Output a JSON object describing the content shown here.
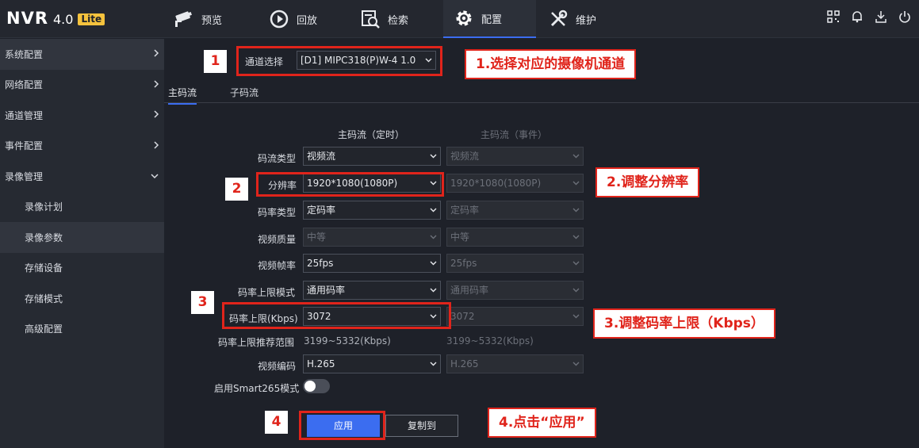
{
  "app": {
    "logo": "NVR",
    "version": "4.0",
    "edition": "Lite"
  },
  "nav": [
    {
      "label": "预览",
      "icon": "camera-icon"
    },
    {
      "label": "回放",
      "icon": "playback-icon"
    },
    {
      "label": "检索",
      "icon": "search-icon"
    },
    {
      "label": "配置",
      "icon": "gear-icon",
      "active": true
    },
    {
      "label": "维护",
      "icon": "wrench-icon"
    }
  ],
  "top_right_icons": [
    "qr-code-icon",
    "bell-icon",
    "download-icon",
    "power-icon"
  ],
  "sidebar": [
    {
      "label": "系统配置",
      "expandable": true
    },
    {
      "label": "网络配置",
      "expandable": true
    },
    {
      "label": "通道管理",
      "expandable": true
    },
    {
      "label": "事件配置",
      "expandable": true
    },
    {
      "label": "录像管理",
      "expanded": true
    },
    {
      "label": "录像计划",
      "sub": true
    },
    {
      "label": "录像参数",
      "sub": true,
      "active": true
    },
    {
      "label": "存储设备",
      "sub": true
    },
    {
      "label": "存储模式",
      "sub": true
    },
    {
      "label": "高级配置",
      "sub": true
    }
  ],
  "channel": {
    "label": "通道选择",
    "value": "[D1] MIPC318(P)W-4 1.0"
  },
  "tabs": [
    {
      "label": "主码流",
      "active": true
    },
    {
      "label": "子码流"
    }
  ],
  "columns": {
    "timed": "主码流（定时）",
    "event": "主码流（事件）"
  },
  "fields": [
    {
      "label": "码流类型",
      "timed": "视频流",
      "event": "视频流"
    },
    {
      "label": "分辨率",
      "timed": "1920*1080(1080P)",
      "event": "1920*1080(1080P)"
    },
    {
      "label": "码率类型",
      "timed": "定码率",
      "event": "定码率"
    },
    {
      "label": "视频质量",
      "timed": "中等",
      "event": "中等"
    },
    {
      "label": "视频帧率",
      "timed": "25fps",
      "event": "25fps"
    },
    {
      "label": "码率上限模式",
      "timed": "通用码率",
      "event": "通用码率"
    },
    {
      "label": "码率上限(Kbps)",
      "timed": "3072",
      "event": "3072"
    }
  ],
  "bitrate_range": {
    "label": "码率上限推荐范围",
    "timed": "3199~5332(Kbps)",
    "event": "3199~5332(Kbps)"
  },
  "encoding": {
    "label": "视频编码",
    "timed": "H.265",
    "event": "H.265"
  },
  "smart265": {
    "label": "启用Smart265模式",
    "on": false
  },
  "buttons": {
    "apply": "应用",
    "copy": "复制到"
  },
  "annotations": {
    "n1": "1",
    "n2": "2",
    "n3": "3",
    "n4": "4",
    "c1": "1.选择对应的摄像机通道",
    "c2": "2.调整分辨率",
    "c3": "3.调整码率上限（Kbps）",
    "c4": "4.点击“应用”"
  },
  "colors": {
    "accent": "#3b6df0",
    "annotation": "#e0241b",
    "lite_badge": "#f5c23d"
  }
}
